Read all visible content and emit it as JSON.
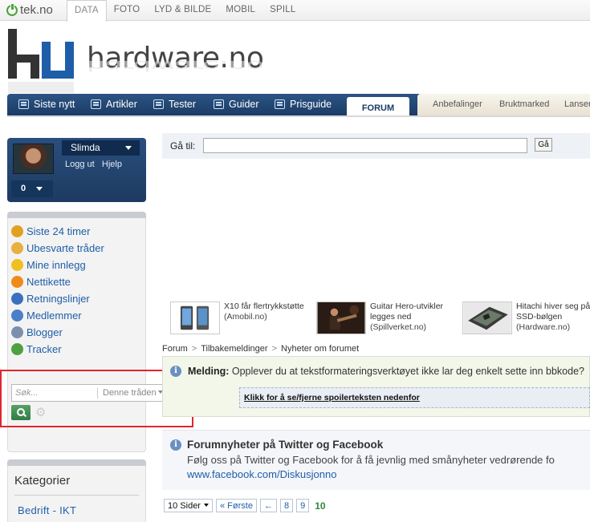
{
  "top": {
    "logo": "tek.no",
    "nav": [
      "DATA",
      "FOTO",
      "LYD & BILDE",
      "MOBIL",
      "SPILL"
    ]
  },
  "brand": {
    "title": "hardware.no"
  },
  "mainnav": {
    "items": [
      "Siste nytt",
      "Artikler",
      "Tester",
      "Guider",
      "Prisguide"
    ],
    "forum": "FORUM",
    "side": [
      "Anbefalinger",
      "Bruktmarked",
      "Lanser"
    ]
  },
  "user": {
    "name": "Slimda",
    "logout": "Logg ut",
    "help": "Hjelp",
    "count": "0"
  },
  "quicklinks": [
    {
      "label": "Siste 24 timer",
      "icon": "clock-icon",
      "color": "#e0a020"
    },
    {
      "label": "Ubesvarte tråder",
      "icon": "envelope-icon",
      "color": "#e8b040"
    },
    {
      "label": "Mine innlegg",
      "icon": "smiley-icon",
      "color": "#f0c020"
    },
    {
      "label": "Nettikette",
      "icon": "warning-icon",
      "color": "#f08a1a"
    },
    {
      "label": "Retningslinjer",
      "icon": "accessibility-icon",
      "color": "#3a6fc0"
    },
    {
      "label": "Medlemmer",
      "icon": "members-icon",
      "color": "#4a7fc9"
    },
    {
      "label": "Blogger",
      "icon": "blog-icon",
      "color": "#7a8fb0"
    },
    {
      "label": "Tracker",
      "icon": "bug-icon",
      "color": "#4fa040"
    }
  ],
  "search": {
    "placeholder": "Søk...",
    "scope": "Denne tråden"
  },
  "categories": {
    "title": "Kategorier",
    "first": "Bedrift - IKT"
  },
  "goto": {
    "label": "Gå til:",
    "button": "Gå"
  },
  "tiles": [
    {
      "text": "X10 får flertrykkstøtte",
      "source": "(Amobil.no)"
    },
    {
      "text": "Guitar Hero-utvikler legges ned",
      "source": "(Spillverket.no)"
    },
    {
      "text": "Hitachi hiver seg på SSD-bølgen",
      "source": "(Hardware.no)"
    }
  ],
  "breadcrumb": [
    "Forum",
    "Tilbakemeldinger",
    "Nyheter om forumet"
  ],
  "message": {
    "label": "Melding:",
    "text": "Opplever du at tekstformateringsverktøyet ikke lar deg enkelt sette inn bbkode?",
    "spoiler": "Klikk for å se/fjerne spoilerteksten nedenfor"
  },
  "news": {
    "title": "Forumnyheter på Twitter og Facebook",
    "body": "Følg oss på Twitter og Facebook for å få jevnlig med smånyheter vedrørende fo",
    "link": "www.facebook.com/Diskusjonno"
  },
  "pager": {
    "pages_label": "10 Sider",
    "first": "« Første",
    "prev": "←",
    "pages": [
      "8",
      "9"
    ],
    "current": "10"
  }
}
